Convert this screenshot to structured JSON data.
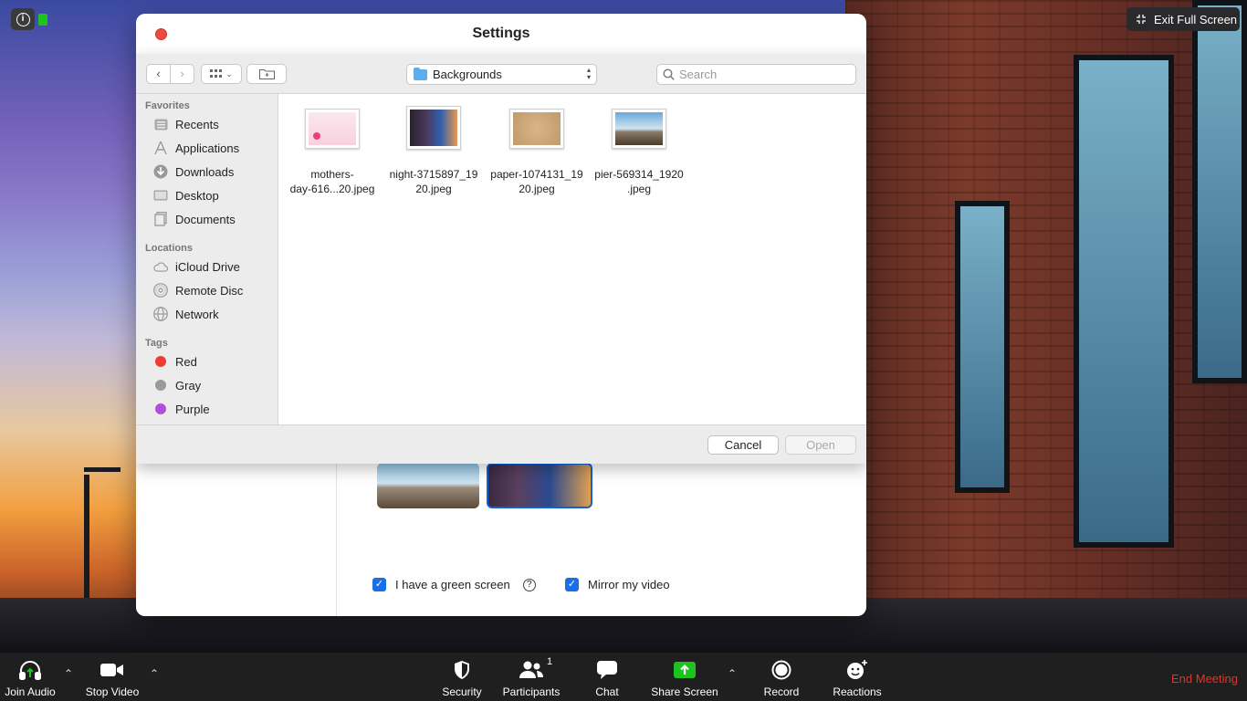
{
  "top": {
    "exit_fullscreen": "Exit Full Screen"
  },
  "settings": {
    "title": "Settings",
    "green_screen_label": "I have a green screen",
    "mirror_label": "Mirror my video"
  },
  "dialog": {
    "location": "Backgrounds",
    "search_placeholder": "Search",
    "sidebar": {
      "favorites_header": "Favorites",
      "favorites": [
        "Recents",
        "Applications",
        "Downloads",
        "Desktop",
        "Documents"
      ],
      "locations_header": "Locations",
      "locations": [
        "iCloud Drive",
        "Remote Disc",
        "Network"
      ],
      "tags_header": "Tags",
      "tags": [
        {
          "label": "Red",
          "color": "#ee3b33"
        },
        {
          "label": "Gray",
          "color": "#9a9a9a"
        },
        {
          "label": "Purple",
          "color": "#b24ed8"
        }
      ]
    },
    "files": [
      {
        "line1": "mothers-",
        "line2": "day-616...20.jpeg"
      },
      {
        "line1": "night-3715897_19",
        "line2": "20.jpeg"
      },
      {
        "line1": "paper-1074131_19",
        "line2": "20.jpeg"
      },
      {
        "line1": "pier-569314_1920",
        "line2": ".jpeg"
      }
    ],
    "cancel": "Cancel",
    "open": "Open"
  },
  "toolbar": {
    "join_audio": "Join Audio",
    "stop_video": "Stop Video",
    "security": "Security",
    "participants": "Participants",
    "participant_count": "1",
    "chat": "Chat",
    "share_screen": "Share Screen",
    "record": "Record",
    "reactions": "Reactions",
    "end_meeting": "End Meeting"
  },
  "colors": {
    "accent": "#1a6fe8",
    "end_meeting": "#e8312a",
    "share_green": "#1ec41e"
  }
}
